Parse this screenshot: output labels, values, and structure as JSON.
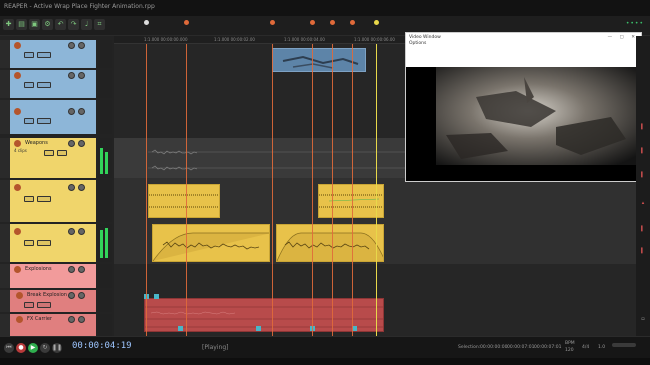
{
  "window": {
    "title": "REAPER - Active Wrap Place Fighter Animation.rpp"
  },
  "toolbar": {
    "status": "••••"
  },
  "ruler": {
    "ticks": [
      "1:1.000 00:00:00.000",
      "1:1.000 00:00:02.00",
      "1:1.000 00:00:04.00",
      "1:1.000 00:00:06.00",
      "1:1.000 00:00:08.00"
    ]
  },
  "tracks": [
    {
      "name": "",
      "sub": "",
      "color": "blue"
    },
    {
      "name": "",
      "sub": "",
      "color": "blue"
    },
    {
      "name": "",
      "sub": "",
      "color": "blue"
    },
    {
      "name": "Weapons",
      "sub": "4 clips",
      "color": "yellow"
    },
    {
      "name": "",
      "sub": "",
      "color": "yellow"
    },
    {
      "name": "",
      "sub": "",
      "color": "yellow"
    },
    {
      "name": "Explosions",
      "sub": "",
      "color": "pink"
    },
    {
      "name": "Break Explosion",
      "sub": "",
      "color": "pinkdeep"
    },
    {
      "name": "FX Carrier",
      "sub": "",
      "color": "pinkdeep"
    }
  ],
  "preview": {
    "title": "Video Window",
    "menu": "Options",
    "controls": "— ▢ ✕"
  },
  "transport": {
    "timecode": "00:00:04:19",
    "state": "[Playing]",
    "selection_label": "Selection:",
    "sel_start": "00:00:00:00",
    "sel_end": "00:00:07:01",
    "sel_len": "00:00:07:01",
    "bpm_label": "BPM",
    "bpm": "120",
    "ts": "4/4",
    "rate": "1.0"
  },
  "colors": {
    "blue_track": "#8db6d8",
    "yellow_track": "#f0d56b",
    "pink_track": "#f29b9b",
    "clip_yellow": "#e8c24a",
    "clip_blue": "#5d84a8",
    "clip_red": "#b84b4b",
    "marker_orange": "#e06a3a",
    "playhead": "#e8d84a"
  }
}
